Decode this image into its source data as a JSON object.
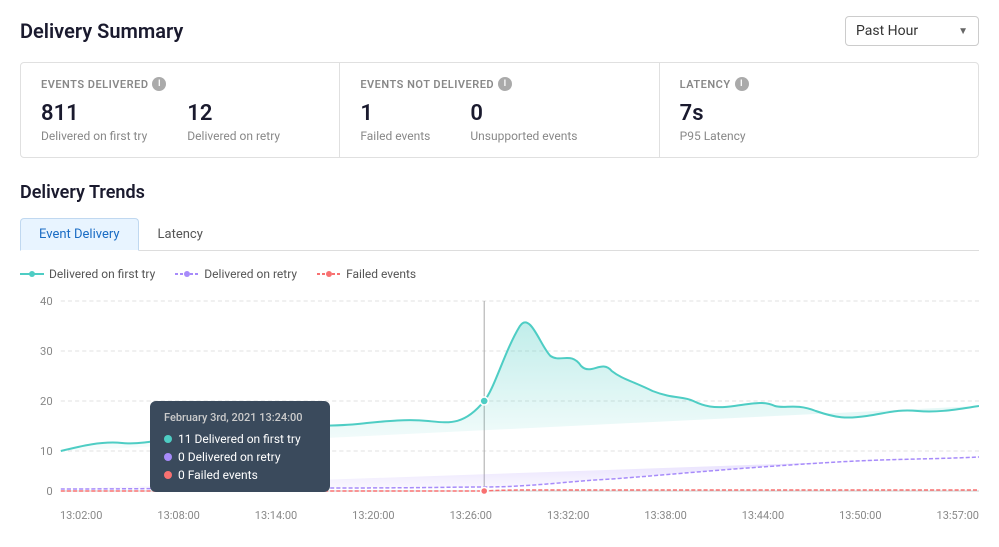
{
  "header": {
    "title": "Delivery Summary",
    "timeSelector": {
      "label": "Past Hour",
      "chevron": "▼"
    }
  },
  "summary": {
    "groups": [
      {
        "id": "events-delivered",
        "label": "EVENTS DELIVERED",
        "items": [
          {
            "value": "811",
            "subLabel": "Delivered on first try"
          },
          {
            "value": "12",
            "subLabel": "Delivered on retry"
          }
        ]
      },
      {
        "id": "events-not-delivered",
        "label": "EVENTS NOT DELIVERED",
        "items": [
          {
            "value": "1",
            "subLabel": "Failed events"
          },
          {
            "value": "0",
            "subLabel": "Unsupported events"
          }
        ]
      },
      {
        "id": "latency",
        "label": "LATENCY",
        "items": [
          {
            "value": "7s",
            "subLabel": "P95 Latency"
          }
        ]
      }
    ]
  },
  "trends": {
    "title": "Delivery Trends",
    "tabs": [
      {
        "label": "Event Delivery",
        "active": true
      },
      {
        "label": "Latency",
        "active": false
      }
    ],
    "legend": [
      {
        "label": "Delivered on first try",
        "color": "#4ecdc4",
        "type": "line-dot"
      },
      {
        "label": "Delivered on retry",
        "color": "#a78bfa",
        "type": "line-dot"
      },
      {
        "label": "Failed events",
        "color": "#f87171",
        "type": "line-dot"
      }
    ],
    "yLabels": [
      "0",
      "10",
      "20",
      "30",
      "40"
    ],
    "xLabels": [
      "13:02:00",
      "13:08:00",
      "13:14:00",
      "13:20:00",
      "13:26:00",
      "13:32:00",
      "13:38:00",
      "13:44:00",
      "13:50:00",
      "13:57:00"
    ],
    "tooltip": {
      "date": "February 3rd, 2021 13:24:00",
      "rows": [
        {
          "color": "#4ecdc4",
          "text": "11 Delivered on first try"
        },
        {
          "color": "#a78bfa",
          "text": "0 Delivered on retry"
        },
        {
          "color": "#f87171",
          "text": "0 Failed events"
        }
      ]
    }
  }
}
